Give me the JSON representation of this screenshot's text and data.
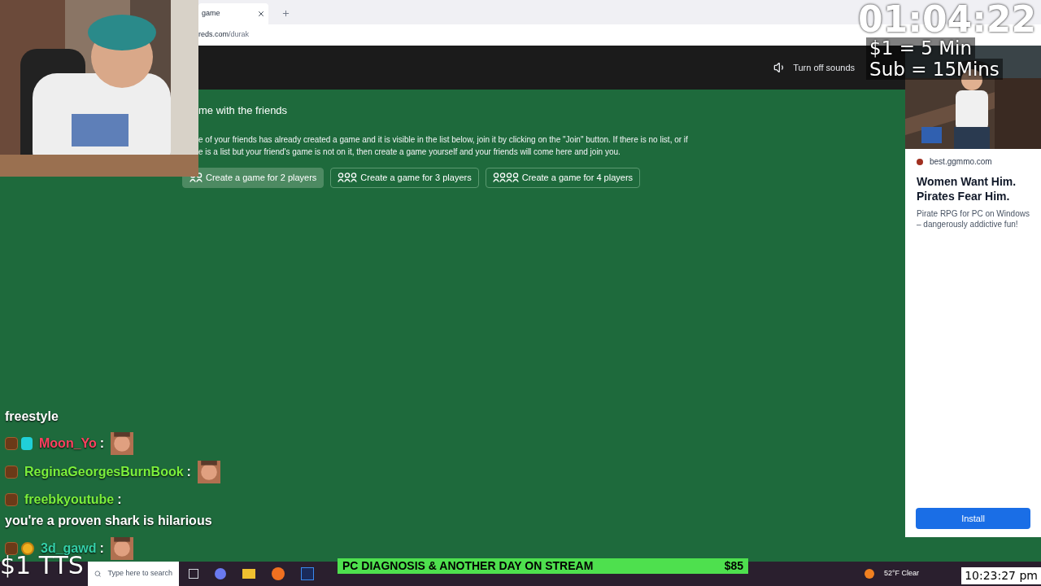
{
  "browser": {
    "tab_title": "game",
    "url_host": "reds.com",
    "url_path": "/durak"
  },
  "site_header": {
    "sound_button": "Turn off sounds"
  },
  "content": {
    "heading": "me with the friends",
    "paragraph": [
      "e of your friends has already created a game and it is visible in the list below, join it by clicking on the \"Join\" button. If there is no list, or if",
      "e is a list but your friend's game is not on it, then create a game yourself and your friends will come here and join you."
    ],
    "buttons": [
      {
        "label": "Create a game for 2 players",
        "kind": "two",
        "selected": true
      },
      {
        "label": "Create a game for 3 players",
        "kind": "three",
        "selected": false
      },
      {
        "label": "Create a game for 4 players",
        "kind": "four",
        "selected": false
      }
    ]
  },
  "ad": {
    "kind": "picture",
    "source": "best.ggmmo.com",
    "headline": "Women Want Him. Pirates Fear Him.",
    "body": "Pirate RPG for PC on Windows – dangerously addictive fun!",
    "button": "Install"
  },
  "overlay": {
    "timer": "01:04:22",
    "rate_lines": [
      "$1 = 5 Min",
      "Sub = 15Mins"
    ],
    "tts": "$1 TTS",
    "goal": {
      "title": "PC DIAGNOSIS & ANOTHER DAY ON STREAM",
      "amount": "$85"
    },
    "chat": [
      {
        "kind": "text",
        "text": "freestyle"
      },
      {
        "kind": "message",
        "user": "Moon_Yo",
        "color": "#ff4060",
        "badges": [
          {
            "kind": "sub"
          },
          {
            "kind": "cyan"
          }
        ],
        "separator": ":",
        "emote": true
      },
      {
        "kind": "message",
        "user": "ReginaGeorgesBurnBook",
        "color": "#7cf03c",
        "badges": [
          {
            "kind": "sub"
          }
        ],
        "separator": ":",
        "emote": true
      },
      {
        "kind": "message",
        "user": "freebkyoutube",
        "color": "#7cf03c",
        "badges": [
          {
            "kind": "sub"
          }
        ],
        "separator": ":",
        "text": "you're a proven shark is hilarious"
      },
      {
        "kind": "message",
        "user": "3d_gawd",
        "color": "#34d0a8",
        "badges": [
          {
            "kind": "sub"
          },
          {
            "kind": "gold"
          }
        ],
        "separator": ":",
        "emote": true
      }
    ]
  },
  "taskbar": {
    "search_placeholder": "Type here to search",
    "weather": "52°F Clear",
    "clock": "10:23:27 pm"
  }
}
